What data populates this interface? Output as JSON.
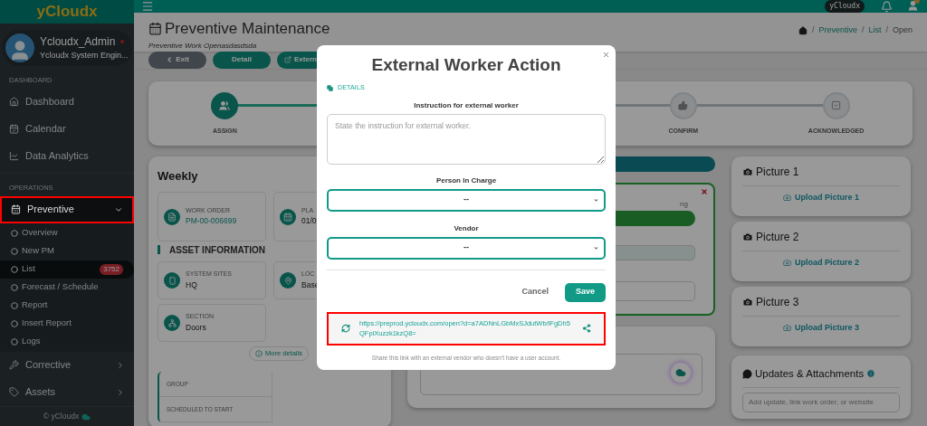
{
  "topbar": {
    "logo": "yCloudx",
    "tenant": "yCloudx"
  },
  "profile": {
    "name": "Ycloudx_Admin",
    "role": "Ycloudx System Engin...",
    "online": true
  },
  "sidebar": {
    "sections": [
      {
        "heading": "DASHBOARD",
        "items": [
          {
            "label": "Dashboard",
            "expanded": false
          },
          {
            "label": "Calendar",
            "expanded": false
          },
          {
            "label": "Data Analytics",
            "expanded": false
          }
        ]
      },
      {
        "heading": "OPERATIONS",
        "items": [
          {
            "label": "Preventive",
            "expanded": true,
            "highlighted": true,
            "children": [
              {
                "label": "Overview",
                "selected": false
              },
              {
                "label": "New PM",
                "selected": false
              },
              {
                "label": "List",
                "selected": true,
                "badge": "3752"
              },
              {
                "label": "Forecast / Schedule",
                "selected": false
              },
              {
                "label": "Report",
                "selected": false
              },
              {
                "label": "Insert Report",
                "selected": false
              },
              {
                "label": "Logs",
                "selected": false
              }
            ]
          },
          {
            "label": "Corrective",
            "expanded": false,
            "highlighted": false
          },
          {
            "label": "Assets",
            "expanded": false,
            "highlighted": false
          }
        ]
      }
    ],
    "footer": "© yCloudx"
  },
  "page": {
    "title": "Preventive Maintenance",
    "subtitle": "Preventive Work Openasdasdsda",
    "breadcrumb_separator": "/",
    "breadcrumb": [
      {
        "label": "Preventive",
        "link": true
      },
      {
        "label": "List",
        "link": true
      },
      {
        "label": "Open",
        "link": false
      }
    ]
  },
  "toolbar": [
    {
      "label": "Exit",
      "kind": "back"
    },
    {
      "label": "Detail",
      "kind": "primary"
    },
    {
      "label": "Extern",
      "kind": "external"
    }
  ],
  "stepper": [
    {
      "label": "ASSIGN",
      "active": true
    },
    {
      "label": "CONFIRM",
      "active": false
    },
    {
      "label": "ACKNOWLEDGED",
      "active": false
    }
  ],
  "weekly": {
    "title": "Weekly",
    "fields": [
      {
        "label": "WORK ORDER",
        "value": "PM-00-006699",
        "link": true
      },
      {
        "label": "PLA",
        "value": "01/0",
        "link": false
      }
    ],
    "asset_heading": "ASSET INFORMATION",
    "asset_fields": [
      {
        "label": "SYSTEM SITES",
        "value": "HQ"
      },
      {
        "label": "LOC",
        "value": "Base"
      },
      {
        "label": "SECTION",
        "value": "Doors"
      }
    ],
    "more_details": "More details",
    "group_rows": [
      "GROUP",
      "SCHEDULED TO START"
    ]
  },
  "status_card": {
    "label_fragment": "ng"
  },
  "pictures": [
    {
      "title": "Picture 1",
      "upload": "Upload Picture 1"
    },
    {
      "title": "Picture 2",
      "upload": "Upload Picture 2"
    },
    {
      "title": "Picture 3",
      "upload": "Upload Picture 3"
    }
  ],
  "updates": {
    "title": "Updates & Attachments",
    "placeholder": "Add update, link work order, or website"
  },
  "modal": {
    "title": "External Worker Action",
    "section": "DETAILS",
    "instruction_label": "Instruction for external worker",
    "instruction_placeholder": "State the instruction for external worker.",
    "person_label": "Person In Charge",
    "person_value": "--",
    "vendor_label": "Vendor",
    "vendor_value": "--",
    "cancel": "Cancel",
    "save": "Save",
    "link": "https://preprod.ycloudx.com/open?d=a7ADNnLGbMxSJdutWb/lFgDh5QFpiXuzzk1kzQ8=",
    "link_highlighted": true,
    "help": "Share this link with an external vendor who doesn't have a user account."
  }
}
